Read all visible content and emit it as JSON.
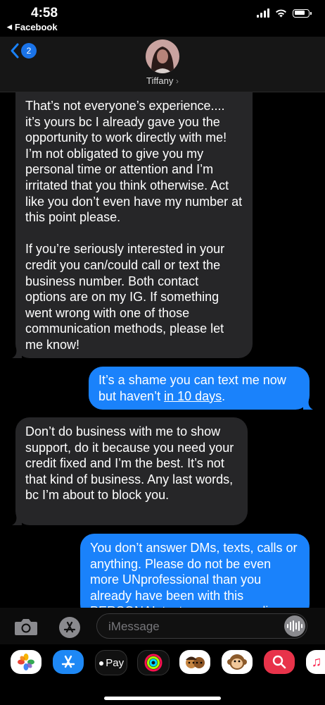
{
  "status_bar": {
    "time": "4:58",
    "back_app": "Facebook"
  },
  "header": {
    "back_count": "2",
    "contact_name": "Tiffany"
  },
  "messages": [
    {
      "side": "incoming",
      "text": "That’s not everyone’s experience.... it’s yours bc I already gave you the opportunity to work directly with me! I’m not obligated to give you my personal time or attention and I’m irritated that you think otherwise. Act like you don’t even have my number at this point please.\n\nIf you’re seriously interested in your credit you can/could call or text the business number. Both contact options are on my IG. If something went wrong with one of those communication methods, please let me know!"
    },
    {
      "side": "outgoing",
      "text_before": "It’s a shame you can text me now but haven’t ",
      "link": "in 10 days",
      "text_after": "."
    },
    {
      "side": "incoming",
      "text": "Don’t do business with me to show support, do it because you need your credit fixed and I’m the best. It’s not that kind of business. Any last words, bc I’m about to block you."
    },
    {
      "side": "outgoing",
      "text": "You don’t answer DMs, texts, calls or anything. Please do not be even more UNprofessional than you already have been with this PERSONAL text message medium"
    }
  ],
  "input": {
    "placeholder": "iMessage"
  },
  "app_drawer": [
    {
      "name": "photos-icon"
    },
    {
      "name": "appstore-icon"
    },
    {
      "name": "applepay-icon",
      "label": "Pay"
    },
    {
      "name": "activity-icon"
    },
    {
      "name": "memoji-icon"
    },
    {
      "name": "animoji-monkey-icon"
    },
    {
      "name": "web-search-icon"
    },
    {
      "name": "music-icon"
    }
  ],
  "colors": {
    "incoming_bubble": "#262628",
    "outgoing_bubble": "#1a82fb",
    "badge": "#1a73e8"
  }
}
